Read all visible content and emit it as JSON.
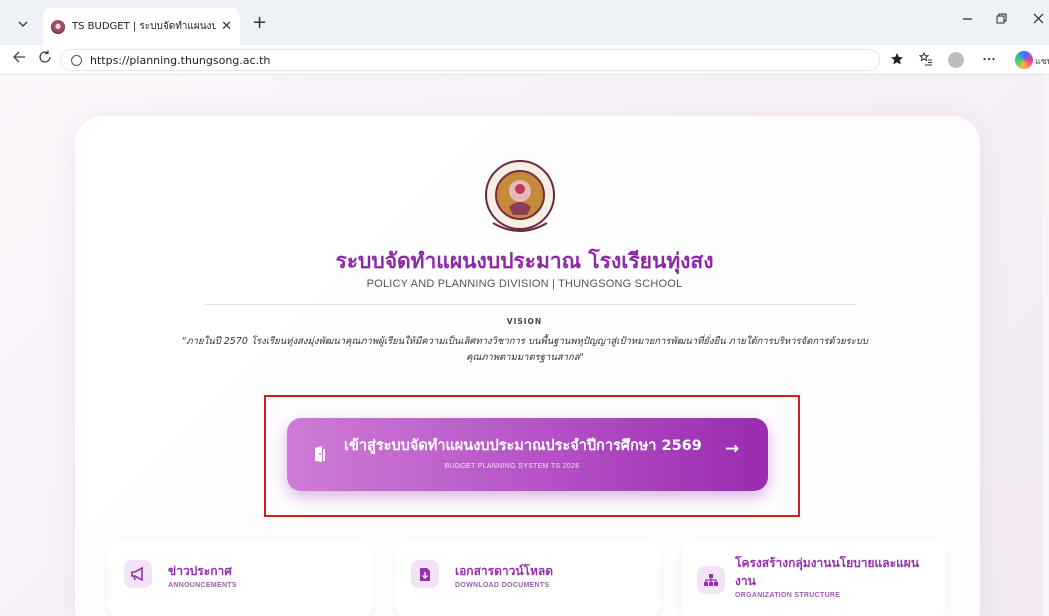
{
  "browser": {
    "tab_title": "TS BUDGET | ระบบจัดทำแผนงบประมาณ",
    "tab_close": "✕",
    "new_tab": "+",
    "url": "https://planning.thungsong.ac.th",
    "copilot_label": "แชท",
    "icons": [
      "tab-dropdown-icon",
      "favicon-icon",
      "back-icon",
      "refresh-icon",
      "lock-icon",
      "favorite-star-icon",
      "favorites-list-icon",
      "profile-icon",
      "more-icon",
      "copilot-icon",
      "minimize-icon",
      "restore-icon",
      "close-icon"
    ]
  },
  "header": {
    "title": "ระบบจัดทำแผนงบประมาณ โรงเรียนทุ่งสง",
    "subtitle": "POLICY AND PLANNING DIVISION | THUNGSONG SCHOOL"
  },
  "vision": {
    "label": "VISION",
    "text": "\"ภายในปี 2570 โรงเรียนทุ่งสงมุ่งพัฒนาคุณภาพผู้เรียนให้มีความเป็นเลิศทางวิชาการ บนพื้นฐานพหุปัญญาสู่เป้าหมายการพัฒนาที่ยั่งยืน ภายใต้การบริหารจัดการด้วยระบบคุณภาพตามมาตรฐานสากล\""
  },
  "cta": {
    "label": "เข้าสู่ระบบจัดทำแผนงบประมาณประจำปีการศึกษา 2569",
    "sublabel": "BUDGET PLANNING SYSTEM TS 2026",
    "arrow": "→"
  },
  "cards": [
    {
      "title": "ข่าวประกาศ",
      "subtitle": "ANNOUNCEMENTS",
      "icon": "megaphone-icon"
    },
    {
      "title": "เอกสารดาวน์โหลด",
      "subtitle": "DOWNLOAD DOCUMENTS",
      "icon": "file-download-icon"
    },
    {
      "title": "โครงสร้างกลุ่มงานนโยบายและแผนงาน",
      "subtitle": "ORGANIZATION STRUCTURE",
      "icon": "org-chart-icon"
    }
  ],
  "colors": {
    "brand_purple": "#8c28a8",
    "cta_gradient_start": "#cf7bd6",
    "cta_gradient_end": "#9a2bb0",
    "highlight_red": "#d51c1c"
  }
}
